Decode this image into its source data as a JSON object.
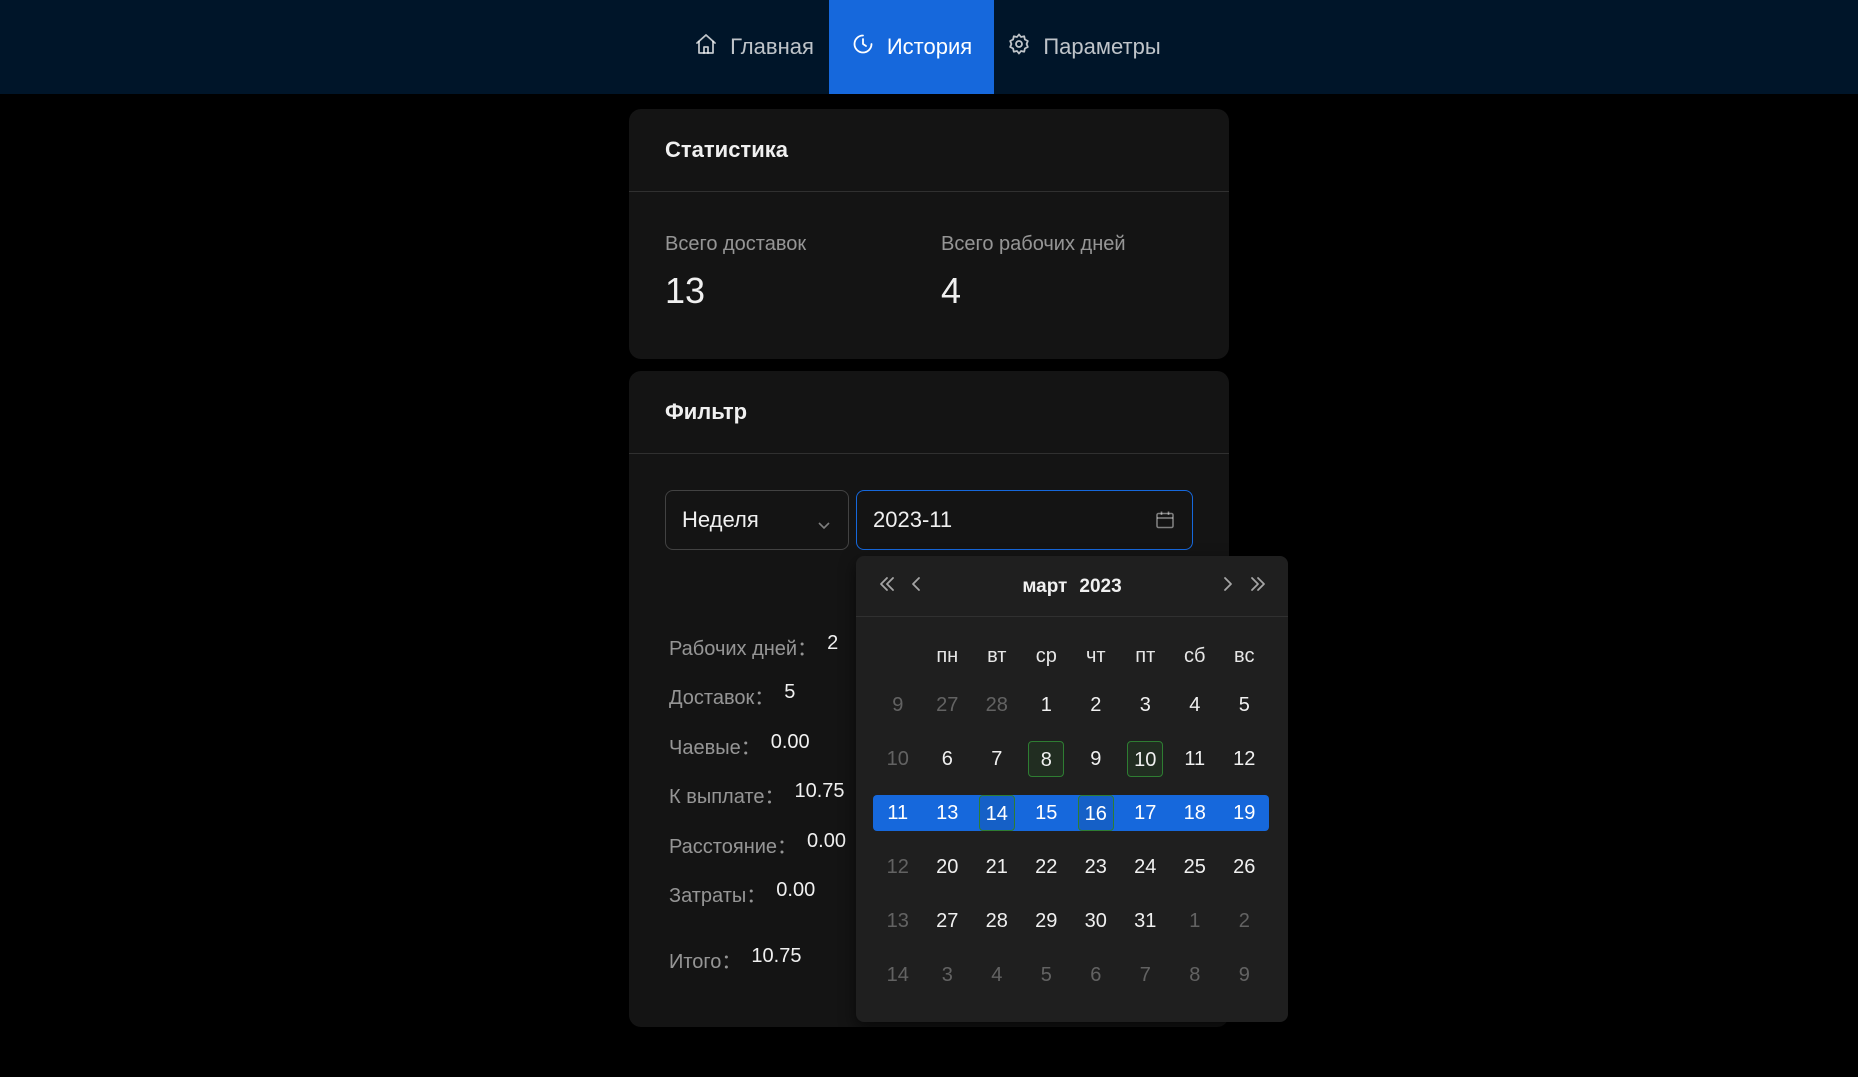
{
  "nav": {
    "items": [
      {
        "label": "Главная",
        "icon": "home-icon",
        "active": false
      },
      {
        "label": "История",
        "icon": "history-icon",
        "active": true
      },
      {
        "label": "Параметры",
        "icon": "gear-icon",
        "active": false
      }
    ]
  },
  "stats": {
    "title": "Статистика",
    "deliveries_label": "Всего доставок",
    "deliveries_value": "13",
    "workdays_label": "Всего рабочих дней",
    "workdays_value": "4"
  },
  "filter": {
    "title": "Фильтр",
    "period_value": "Неделя",
    "date_value": "2023-11",
    "summary": [
      {
        "label": "Рабочих дней：",
        "value": "2"
      },
      {
        "label": "Доставок：",
        "value": "5"
      },
      {
        "label": "Чаевые：",
        "value": "0.00"
      },
      {
        "label": "К выплате：",
        "value": "10.75"
      },
      {
        "label": "Расстояние：",
        "value": "0.00"
      },
      {
        "label": "Затраты：",
        "value": "0.00"
      }
    ],
    "total": {
      "label": "Итого：",
      "value": "10.75"
    }
  },
  "calendar": {
    "month": "март",
    "year": "2023",
    "weekdays": [
      "пн",
      "вт",
      "ср",
      "чт",
      "пт",
      "сб",
      "вс"
    ],
    "weeks": [
      {
        "week": "9",
        "days": [
          {
            "d": "27",
            "out": true
          },
          {
            "d": "28",
            "out": true
          },
          {
            "d": "1"
          },
          {
            "d": "2"
          },
          {
            "d": "3"
          },
          {
            "d": "4"
          },
          {
            "d": "5"
          }
        ]
      },
      {
        "week": "10",
        "days": [
          {
            "d": "6"
          },
          {
            "d": "7"
          },
          {
            "d": "8",
            "marked": true
          },
          {
            "d": "9"
          },
          {
            "d": "10",
            "marked": true
          },
          {
            "d": "11"
          },
          {
            "d": "12"
          }
        ]
      },
      {
        "week": "11",
        "selected": true,
        "days": [
          {
            "d": "13"
          },
          {
            "d": "14",
            "marked": true
          },
          {
            "d": "15"
          },
          {
            "d": "16",
            "marked": true
          },
          {
            "d": "17"
          },
          {
            "d": "18"
          },
          {
            "d": "19"
          }
        ]
      },
      {
        "week": "12",
        "days": [
          {
            "d": "20"
          },
          {
            "d": "21"
          },
          {
            "d": "22"
          },
          {
            "d": "23"
          },
          {
            "d": "24"
          },
          {
            "d": "25"
          },
          {
            "d": "26"
          }
        ]
      },
      {
        "week": "13",
        "days": [
          {
            "d": "27"
          },
          {
            "d": "28"
          },
          {
            "d": "29"
          },
          {
            "d": "30"
          },
          {
            "d": "31"
          },
          {
            "d": "1",
            "out": true
          },
          {
            "d": "2",
            "out": true
          }
        ]
      },
      {
        "week": "14",
        "days": [
          {
            "d": "3",
            "out": true
          },
          {
            "d": "4",
            "out": true
          },
          {
            "d": "5",
            "out": true
          },
          {
            "d": "6",
            "out": true
          },
          {
            "d": "7",
            "out": true
          },
          {
            "d": "8",
            "out": true
          },
          {
            "d": "9",
            "out": true
          }
        ]
      }
    ]
  },
  "colors": {
    "nav_bg": "#001529",
    "accent": "#1668dc",
    "card_bg": "#141414",
    "popup_bg": "#1f1f1f",
    "marked_border": "#2e7d32"
  }
}
